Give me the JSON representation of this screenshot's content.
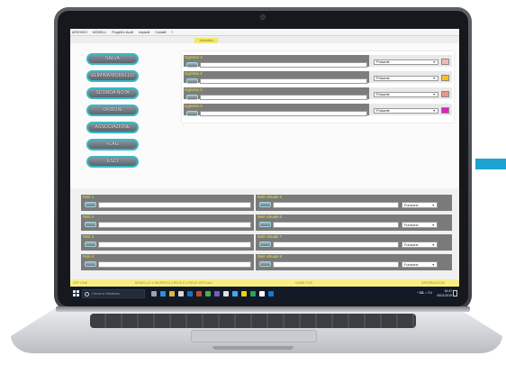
{
  "menubar": {
    "items": [
      "ARCHIVIO",
      "MODELLI",
      "Progetti e Audit",
      "Impianti",
      "Contatti",
      "?"
    ]
  },
  "mode_bar": {
    "label": "Modalità"
  },
  "buttons": [
    {
      "label": "SALVA"
    },
    {
      "label": "ELIMINA MODELLO"
    },
    {
      "label": "SCORDA NOTA"
    },
    {
      "label": "OPZIONI"
    },
    {
      "label": "ASSOCIAZIONE"
    },
    {
      "label": "FLAG"
    },
    {
      "label": "ESCI"
    }
  ],
  "inputs": [
    {
      "label": "Ingresso 1",
      "value": "",
      "select": "Pulsante",
      "color": "#f0b9b9"
    },
    {
      "label": "Ingresso 2",
      "value": "",
      "select": "Pulsante",
      "color": "#f5c024"
    },
    {
      "label": "Ingresso 3",
      "value": "",
      "select": "Pulsante",
      "color": "#e8978c"
    },
    {
      "label": "Ingresso 4",
      "value": "",
      "select": "Pulsante",
      "color": "#e020c0"
    }
  ],
  "relays": [
    {
      "label": "Relè 1",
      "value": ""
    },
    {
      "label": "Relè 2",
      "value": ""
    },
    {
      "label": "Relè 3",
      "value": ""
    },
    {
      "label": "Relè 4",
      "value": ""
    }
  ],
  "virtual_relays": [
    {
      "label": "Relè virtuale 5",
      "value": "",
      "select": "Funzione"
    },
    {
      "label": "Relè virtuale 6",
      "value": "",
      "select": "Funzione"
    },
    {
      "label": "Relè virtuale 7",
      "value": "",
      "select": "Funzione"
    },
    {
      "label": "Relè virtuale 8",
      "value": "",
      "select": "Funzione"
    }
  ],
  "status": {
    "left": "OFF LINE",
    "center": "MODELLO 4 INGRESSI 4 RELÈ E 4 RELÈ VIRTUALI",
    "mid_right": "NOME FILE",
    "right": "INFORMAZIONI"
  },
  "taskbar": {
    "search_placeholder": "Cerca in Windows",
    "tray": "^ ⌨ ♪ ITA",
    "time": "16:47",
    "date": "05/11/2019"
  },
  "colors": {
    "button_border": "#37b9c4",
    "label_yellow": "#e8e43c",
    "status_bar": "#f7ef84",
    "accent": "#1ea3d0"
  }
}
